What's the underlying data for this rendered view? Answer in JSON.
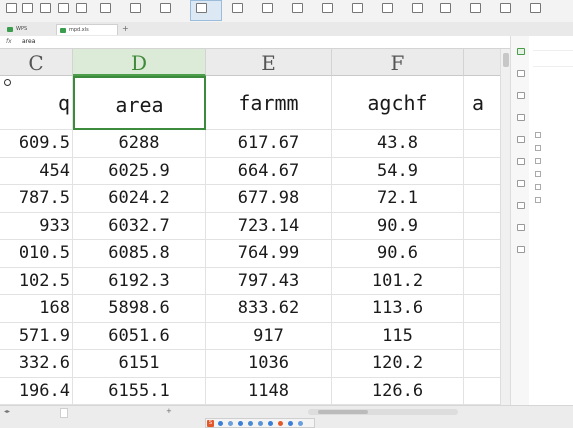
{
  "toolbar": {
    "items": [
      "",
      "",
      "",
      "",
      "",
      "",
      "",
      "",
      "",
      "",
      "",
      "",
      ""
    ],
    "active_index": 2
  },
  "tabs": [
    {
      "label": "WPS"
    },
    {
      "label": "mpd.xls"
    }
  ],
  "formula_bar": {
    "fx": "fx",
    "value": "area"
  },
  "columns": [
    "C",
    "D",
    "E",
    "F",
    ""
  ],
  "selected_column": "D",
  "rows": [
    [
      "q",
      "area",
      "farmm",
      "agchf",
      "a"
    ],
    [
      "609.5",
      "6288",
      "617.67",
      "43.8",
      ""
    ],
    [
      "454",
      "6025.9",
      "664.67",
      "54.9",
      ""
    ],
    [
      "787.5",
      "6024.2",
      "677.98",
      "72.1",
      ""
    ],
    [
      "933",
      "6032.7",
      "723.14",
      "90.9",
      ""
    ],
    [
      "010.5",
      "6085.8",
      "764.99",
      "90.6",
      ""
    ],
    [
      "102.5",
      "6192.3",
      "797.43",
      "101.2",
      ""
    ],
    [
      "168",
      "5898.6",
      "833.62",
      "113.6",
      ""
    ],
    [
      "571.9",
      "6051.6",
      "917",
      "115",
      ""
    ],
    [
      "332.6",
      "6151",
      "1036",
      "120.2",
      ""
    ],
    [
      "196.4",
      "6155.1",
      "1148",
      "126.6",
      ""
    ]
  ],
  "sidebar": {
    "items": [
      "",
      "",
      "",
      "",
      "",
      "",
      "",
      "",
      "",
      ""
    ]
  },
  "task_pane": {
    "title": "",
    "link": "",
    "items": [
      "",
      "",
      "",
      "",
      "",
      ""
    ]
  },
  "status": {
    "sheet_tabs": [
      "",
      "",
      ""
    ]
  },
  "colors": {
    "accent": "#3c8a3c",
    "header_bg": "#ebebeb",
    "selected_header_bg": "#dcebd7"
  }
}
